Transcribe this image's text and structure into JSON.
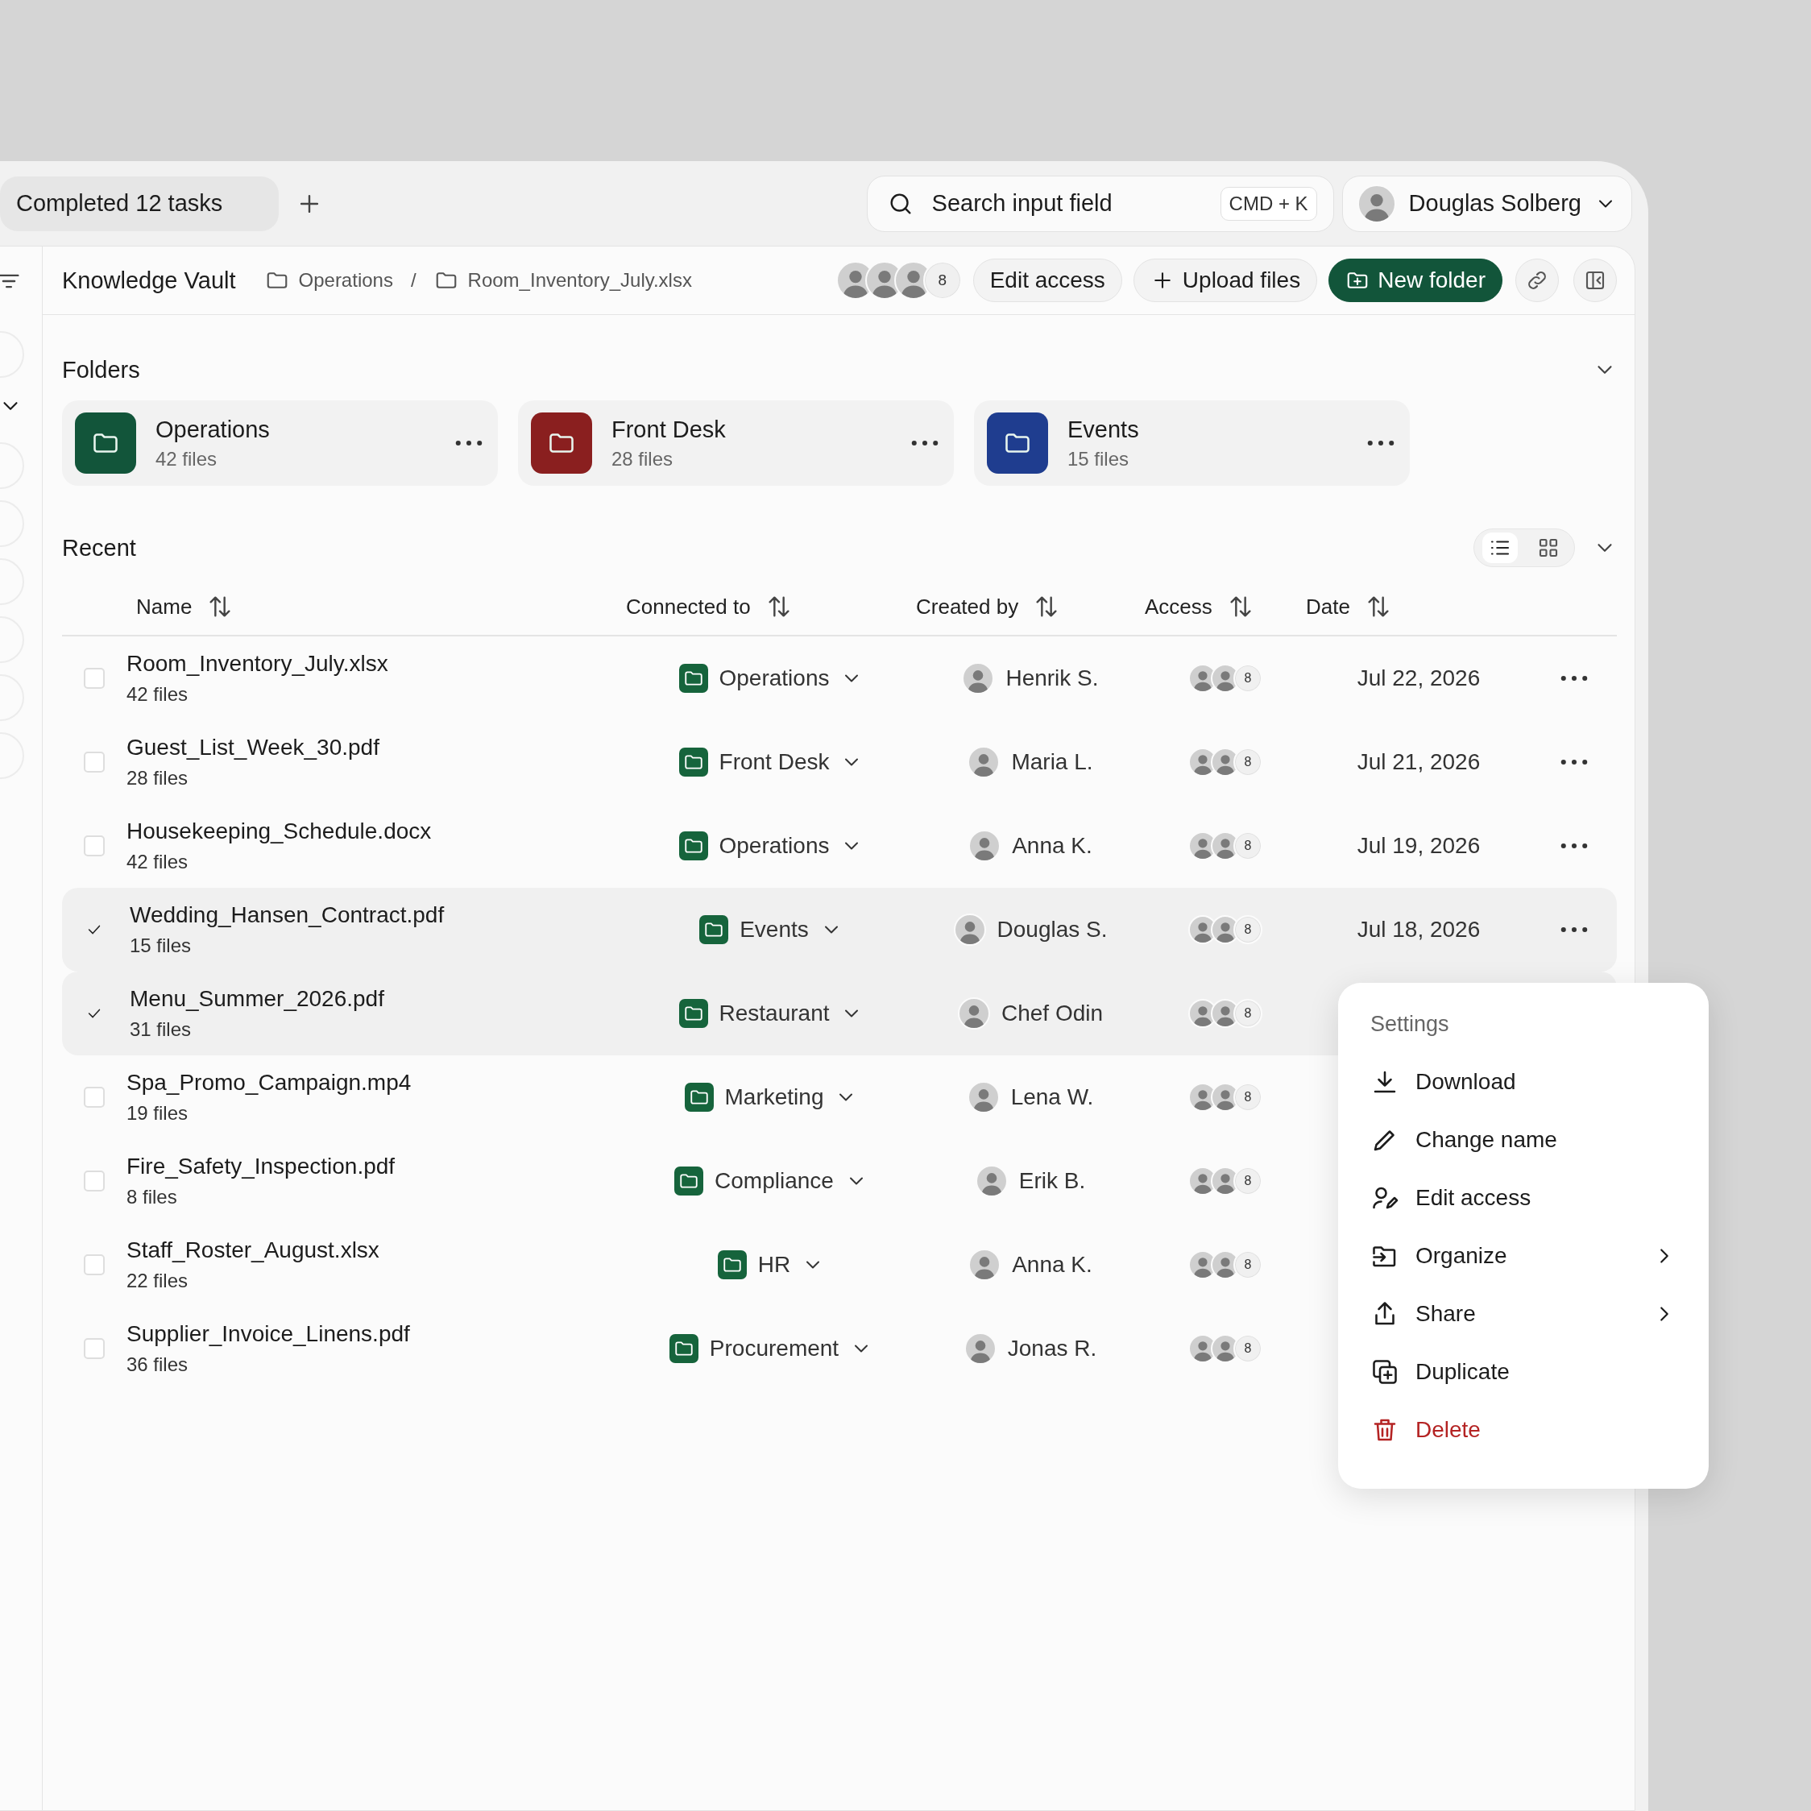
{
  "tabs": [
    {
      "label": "Completed 12 tasks"
    }
  ],
  "search": {
    "placeholder": "Search input field",
    "shortcut": "CMD + K"
  },
  "user": {
    "name": "Douglas Solberg"
  },
  "header": {
    "title": "Knowledge Vault",
    "breadcrumb": [
      "Operations",
      "Room_Inventory_July.xlsx"
    ],
    "separator": "/",
    "members_count": "8",
    "actions": [
      {
        "label": "Edit access",
        "kind": "plain"
      },
      {
        "label": "Upload files",
        "kind": "upload"
      },
      {
        "label": "New folder",
        "kind": "primary"
      }
    ]
  },
  "folders": {
    "title": "Folders",
    "expanded": true,
    "items": [
      {
        "name": "Operations",
        "files": "42 files",
        "color": "#12553a"
      },
      {
        "name": "Front Desk",
        "files": "28 files",
        "color": "#8a1f1f"
      },
      {
        "name": "Events",
        "files": "15 files",
        "color": "#1f3d8f"
      }
    ]
  },
  "recent": {
    "title": "Recent",
    "expanded": true,
    "views": [
      {
        "kind": "list",
        "selected": true
      },
      {
        "kind": "grid",
        "selected": false
      }
    ],
    "columns": [
      "Name",
      "Connected to",
      "Created by",
      "Access",
      "Date"
    ],
    "rows": [
      {
        "name": "Room_Inventory_July.xlsx",
        "files": "42 files",
        "selected": false,
        "connected": "Operations",
        "created_by": "Henrik S.",
        "access_count": "8",
        "date": "Jul 22, 2026"
      },
      {
        "name": "Guest_List_Week_30.pdf",
        "files": "28 files",
        "selected": false,
        "connected": "Front Desk",
        "created_by": "Maria L.",
        "access_count": "8",
        "date": "Jul 21, 2026"
      },
      {
        "name": "Housekeeping_Schedule.docx",
        "files": "42 files",
        "selected": false,
        "connected": "Operations",
        "created_by": "Anna K.",
        "access_count": "8",
        "date": "Jul 19, 2026"
      },
      {
        "name": "Wedding_Hansen_Contract.pdf",
        "files": "15 files",
        "selected": true,
        "connected": "Events",
        "created_by": "Douglas S.",
        "access_count": "8",
        "date": "Jul 18, 2026"
      },
      {
        "name": "Menu_Summer_2026.pdf",
        "files": "31 files",
        "selected": true,
        "connected": "Restaurant",
        "created_by": "Chef Odin",
        "access_count": "8"
      },
      {
        "name": "Spa_Promo_Campaign.mp4",
        "files": "19 files",
        "selected": false,
        "connected": "Marketing",
        "created_by": "Lena W.",
        "access_count": "8"
      },
      {
        "name": "Fire_Safety_Inspection.pdf",
        "files": "8 files",
        "selected": false,
        "connected": "Compliance",
        "created_by": "Erik B.",
        "access_count": "8"
      },
      {
        "name": "Staff_Roster_August.xlsx",
        "files": "22 files",
        "selected": false,
        "connected": "HR",
        "created_by": "Anna K.",
        "access_count": "8"
      },
      {
        "name": "Supplier_Invoice_Linens.pdf",
        "files": "36 files",
        "selected": false,
        "connected": "Procurement",
        "created_by": "Jonas R.",
        "access_count": "8"
      }
    ]
  },
  "menu": {
    "title": "Settings",
    "items": [
      {
        "label": "Download",
        "kind": "download",
        "submenu": false
      },
      {
        "label": "Change name",
        "kind": "rename",
        "submenu": false
      },
      {
        "label": "Edit access",
        "kind": "access",
        "submenu": false
      },
      {
        "label": "Organize",
        "kind": "organize",
        "submenu": true
      },
      {
        "label": "Share",
        "kind": "share",
        "submenu": true
      },
      {
        "label": "Duplicate",
        "kind": "duplicate",
        "submenu": false
      },
      {
        "label": "Delete",
        "kind": "delete",
        "submenu": false
      }
    ]
  }
}
